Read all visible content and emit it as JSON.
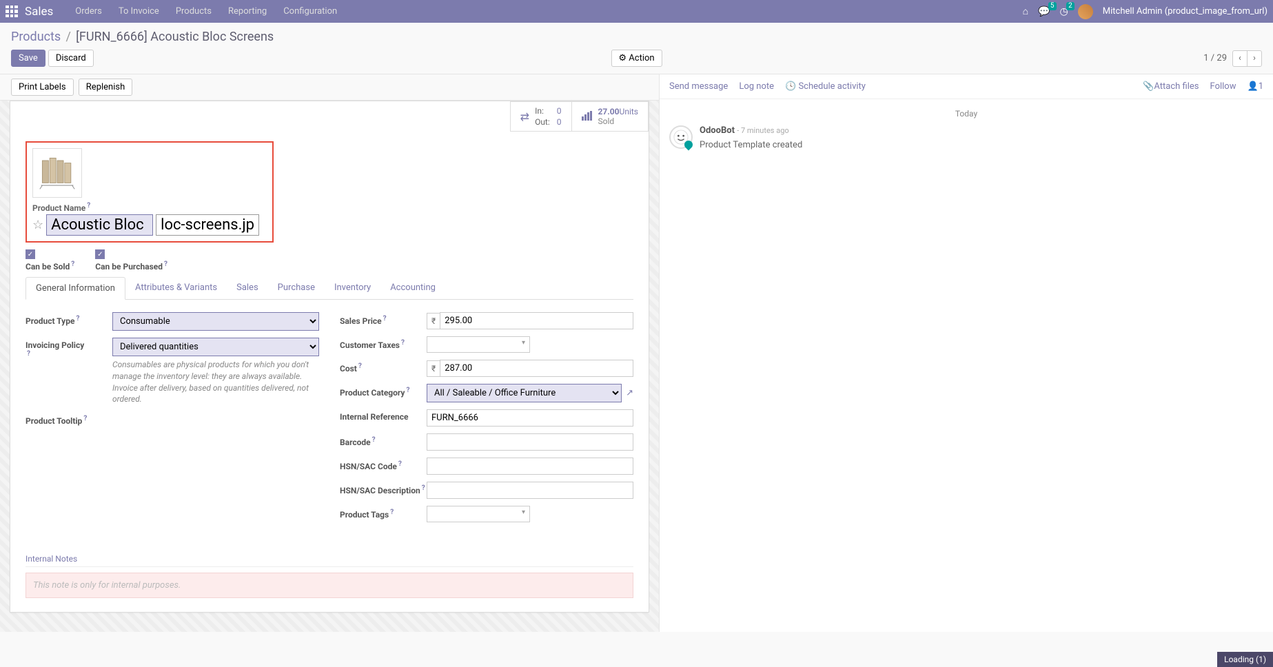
{
  "nav": {
    "brand": "Sales",
    "items": [
      "Orders",
      "To Invoice",
      "Products",
      "Reporting",
      "Configuration"
    ],
    "msg_badge": "5",
    "act_badge": "2",
    "user": "Mitchell Admin (product_image_from_url)"
  },
  "breadcrumb": {
    "parent": "Products",
    "current": "[FURN_6666] Acoustic Bloc Screens"
  },
  "buttons": {
    "save": "Save",
    "discard": "Discard",
    "action": "Action",
    "print_labels": "Print Labels",
    "replenish": "Replenish"
  },
  "pager": {
    "text": "1 / 29"
  },
  "statbuttons": {
    "in_label": "In:",
    "in_val": "0",
    "out_label": "Out:",
    "out_val": "0",
    "sold_val": "27.00",
    "sold_unit": "Units",
    "sold_label": "Sold"
  },
  "product": {
    "name_label": "Product Name",
    "name_value": "Acoustic Bloc",
    "url_value": "loc-screens.jpg",
    "can_be_sold": "Can be Sold",
    "can_be_purchased": "Can be Purchased"
  },
  "tabs": [
    "General Information",
    "Attributes & Variants",
    "Sales",
    "Purchase",
    "Inventory",
    "Accounting"
  ],
  "fields": {
    "product_type_label": "Product Type",
    "product_type_value": "Consumable",
    "invoicing_policy_label": "Invoicing Policy",
    "invoicing_policy_value": "Delivered quantities",
    "hint1": "Consumables are physical products for which you don't manage the inventory level: they are always available.",
    "hint2": "Invoice after delivery, based on quantities delivered, not ordered.",
    "product_tooltip_label": "Product Tooltip",
    "sales_price_label": "Sales Price",
    "sales_price_value": "295.00",
    "customer_taxes_label": "Customer Taxes",
    "cost_label": "Cost",
    "cost_value": "287.00",
    "category_label": "Product Category",
    "category_value": "All / Saleable / Office Furniture",
    "internal_ref_label": "Internal Reference",
    "internal_ref_value": "FURN_6666",
    "barcode_label": "Barcode",
    "hsn_code_label": "HSN/SAC Code",
    "hsn_desc_label": "HSN/SAC Description",
    "product_tags_label": "Product Tags",
    "currency": "₹"
  },
  "internal_notes": {
    "title": "Internal Notes",
    "placeholder": "This note is only for internal purposes."
  },
  "chatter": {
    "send": "Send message",
    "log": "Log note",
    "schedule": "Schedule activity",
    "attach": "Attach files",
    "follow": "Follow",
    "followers": "1",
    "today": "Today",
    "author": "OdooBot",
    "time": "- 7 minutes ago",
    "content": "Product Template created"
  },
  "loading": "Loading (1)"
}
